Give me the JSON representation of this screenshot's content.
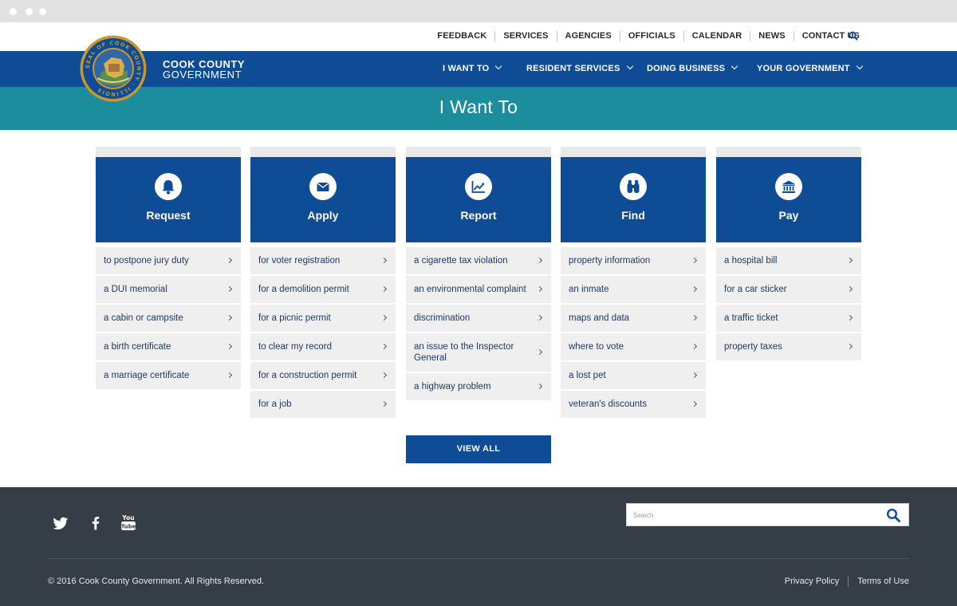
{
  "utility_nav": {
    "items": [
      "FEEDBACK",
      "SERVICES",
      "AGENCIES",
      "OFFICIALS",
      "CALENDAR",
      "NEWS",
      "CONTACT US"
    ]
  },
  "brand": {
    "line1": "COOK COUNTY",
    "line2": "GOVERNMENT",
    "seal_text": "SEAL OF COOK COUNTY · ILLINOIS"
  },
  "main_nav": {
    "items": [
      "I WANT TO",
      "RESIDENT SERVICES",
      "DOING BUSINESS",
      "YOUR GOVERNMENT"
    ]
  },
  "banner": {
    "title": "I Want To"
  },
  "columns": [
    {
      "title": "Request",
      "icon": "bell-icon",
      "items": [
        "to postpone jury duty",
        "a DUI memorial",
        "a cabin or campsite",
        "a birth certificate",
        "a marriage certificate"
      ]
    },
    {
      "title": "Apply",
      "icon": "envelope-icon",
      "items": [
        "for voter registration",
        "for a demolition permit",
        "for a picnic permit",
        "to clear my record",
        "for a construction permit",
        "for a job"
      ]
    },
    {
      "title": "Report",
      "icon": "line-chart-icon",
      "items": [
        "a cigarette tax violation",
        "an environmental complaint",
        "discrimination",
        "an issue to the Inspector General",
        "a highway problem"
      ]
    },
    {
      "title": "Find",
      "icon": "binoculars-icon",
      "items": [
        "property information",
        "an inmate",
        "maps and data",
        "where to vote",
        "a lost pet",
        "veteran's discounts"
      ]
    },
    {
      "title": "Pay",
      "icon": "bank-icon",
      "items": [
        "a hospital bill",
        "for a car sticker",
        "a traffic ticket",
        "property taxes"
      ]
    }
  ],
  "view_all_label": "VIEW ALL",
  "footer": {
    "social": [
      "twitter-icon",
      "facebook-icon",
      "youtube-icon"
    ],
    "search_placeholder": "Search",
    "copyright": "© 2016 Cook County Government. All Rights Reserved.",
    "links": [
      "Privacy Policy",
      "Terms of Use"
    ]
  },
  "colors": {
    "nav_blue": "#0e4c96",
    "teal": "#1b8d9c",
    "footer": "#353d47",
    "seal_gold": "#c9962e"
  }
}
